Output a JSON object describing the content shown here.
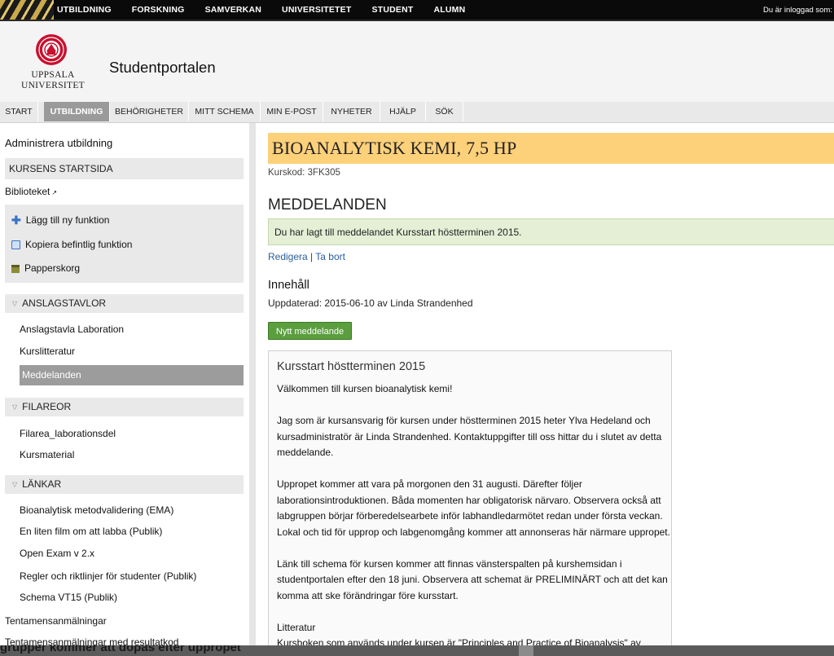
{
  "topnav": {
    "items": [
      "UTBILDNING",
      "FORSKNING",
      "SAMVERKAN",
      "UNIVERSITETET",
      "STUDENT",
      "ALUMN"
    ],
    "login_text": "Du är inloggad som:"
  },
  "header": {
    "logo_line1": "UPPSALA",
    "logo_line2": "UNIVERSITET",
    "portal_title": "Studentportalen"
  },
  "tabs": [
    {
      "label": "START"
    },
    {
      "label": "UTBILDNING"
    },
    {
      "label": "BEHÖRIGHETER"
    },
    {
      "label": "MITT SCHEMA"
    },
    {
      "label": "MIN E-POST"
    },
    {
      "label": "NYHETER"
    },
    {
      "label": "HJÄLP"
    },
    {
      "label": "SÖK"
    }
  ],
  "sidebar": {
    "admin_link": "Administrera utbildning",
    "course_start": "KURSENS STARTSIDA",
    "library": "Biblioteket",
    "tools": [
      "Lägg till ny funktion",
      "Kopiera befintlig funktion",
      "Papperskorg"
    ],
    "sections": [
      {
        "title": "ANSLAGSTAVLOR",
        "items": [
          "Anslagstavla Laboration",
          "Kurslitteratur",
          "Meddelanden"
        ]
      },
      {
        "title": "FILAREOR",
        "items": [
          "Filarea_laborationsdel",
          "Kursmaterial"
        ]
      },
      {
        "title": "LÄNKAR",
        "items": [
          "Bioanalytisk metodvalidering (EMA)",
          "En liten film om att labba (Publik)",
          "Open Exam v 2.x",
          "Regler och riktlinjer för studenter (Publik)",
          "Schema VT15 (Publik)"
        ]
      }
    ],
    "bottom_links": [
      "Tentamensanmälningar",
      "Tentamensanmälningar med resultatkod"
    ]
  },
  "main": {
    "course_title": "BIOANALYTISK KEMI, 7,5 HP",
    "course_code": "Kurskod:  3FK305",
    "section_title": "MEDDELANDEN",
    "notice": "Du har lagt till meddelandet Kursstart höstterminen 2015.",
    "edit_link": "Redigera",
    "separator": "|",
    "delete_link": "Ta bort",
    "content_heading": "Innehåll",
    "updated": "Uppdaterad: 2015-06-10 av Linda Strandenhed",
    "new_button": "Nytt meddelande",
    "message": {
      "title": "Kursstart höstterminen 2015",
      "lines": [
        "Välkommen till kursen bioanalytisk kemi!",
        "",
        "Jag som är kursansvarig för kursen under höstterminen 2015 heter Ylva Hedeland och",
        "kursadministratör är Linda Strandenhed. Kontaktuppgifter till oss hittar du i slutet av detta",
        "meddelande.",
        "",
        "Uppropet kommer att vara på morgonen den 31 augusti. Därefter följer",
        "laborationsintroduktionen. Båda momenten har obligatorisk närvaro. Observera också att",
        "labgruppen börjar förberedelsearbete inför labhandledarmötet redan under första veckan.",
        "Lokal och tid för upprop och labgenomgång kommer att annonseras här närmare uppropet.",
        "",
        "Länk till schema för kursen kommer att finnas vänsterspalten på kurshemsidan i",
        "studentportalen efter den 18 juni. Observera att schemat är PRELIMINÄRT och att det kan",
        "komma att ske förändringar före kursstart.",
        "",
        "Litteratur",
        "Kursboken som används under kursen är \"Principles and Practice of Bioanalysis\" av"
      ]
    }
  },
  "overlay_text": "grupper kommer att dopas efter uppropet",
  "colors": {
    "title_bg": "#fdd07a",
    "notice_bg": "#e4efd6",
    "button_green": "#5a9e3e",
    "link_blue": "#2a5e9a"
  }
}
